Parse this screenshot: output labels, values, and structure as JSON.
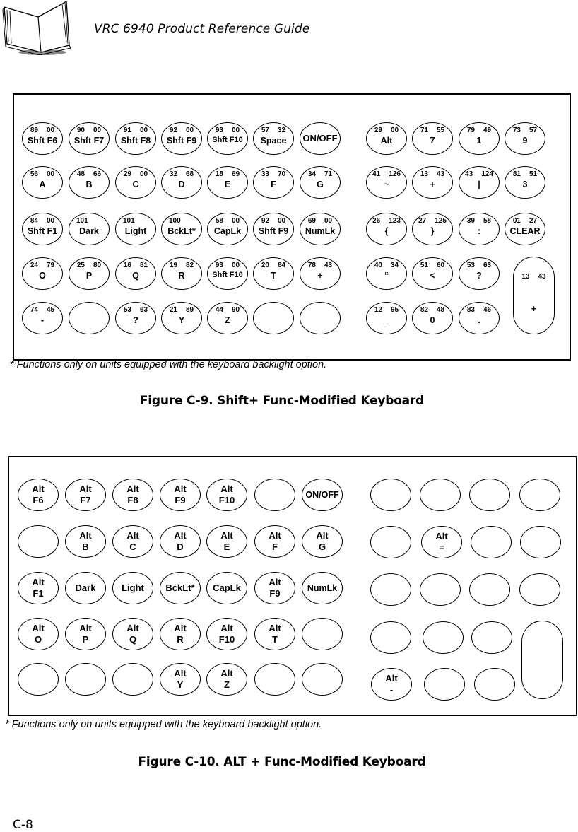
{
  "header": {
    "title": "VRC 6940 Product Reference Guide",
    "icon": "open-book-icon"
  },
  "figure_c9": {
    "caption": "Figure C-9.  Shift+ Func-Modified Keyboard",
    "note": "* Functions only on units equipped with the keyboard backlight option.",
    "main_rows": [
      [
        {
          "codes": [
            "89",
            "00"
          ],
          "label": "Shft F6"
        },
        {
          "codes": [
            "90",
            "00"
          ],
          "label": "Shft F7"
        },
        {
          "codes": [
            "91",
            "00"
          ],
          "label": "Shft F8"
        },
        {
          "codes": [
            "92",
            "00"
          ],
          "label": "Shft F9"
        },
        {
          "codes": [
            "93",
            "00"
          ],
          "label": "Shft F10"
        },
        {
          "codes": [
            "57",
            "32"
          ],
          "label": "Space"
        },
        {
          "codes": [],
          "label": "ON/OFF"
        }
      ],
      [
        {
          "codes": [
            "56",
            "00"
          ],
          "label": "A"
        },
        {
          "codes": [
            "48",
            "66"
          ],
          "label": "B"
        },
        {
          "codes": [
            "29",
            "00"
          ],
          "label": "C"
        },
        {
          "codes": [
            "32",
            "68"
          ],
          "label": "D"
        },
        {
          "codes": [
            "18",
            "69"
          ],
          "label": "E"
        },
        {
          "codes": [
            "33",
            "70"
          ],
          "label": "F"
        },
        {
          "codes": [
            "34",
            "71"
          ],
          "label": "G"
        }
      ],
      [
        {
          "codes": [
            "84",
            "00"
          ],
          "label": "Shft F1"
        },
        {
          "codes": [
            "101"
          ],
          "label": "Dark"
        },
        {
          "codes": [
            "101"
          ],
          "label": "Light"
        },
        {
          "codes": [
            "100"
          ],
          "label": "BckLt*"
        },
        {
          "codes": [
            "58",
            "00"
          ],
          "label": "CapLk"
        },
        {
          "codes": [
            "92",
            "00"
          ],
          "label": "Shft F9"
        },
        {
          "codes": [
            "69",
            "00"
          ],
          "label": "NumLk"
        }
      ],
      [
        {
          "codes": [
            "24",
            "79"
          ],
          "label": "O"
        },
        {
          "codes": [
            "25",
            "80"
          ],
          "label": "P"
        },
        {
          "codes": [
            "16",
            "81"
          ],
          "label": "Q"
        },
        {
          "codes": [
            "19",
            "82"
          ],
          "label": "R"
        },
        {
          "codes": [
            "93",
            "00"
          ],
          "label": "Shft F10"
        },
        {
          "codes": [
            "20",
            "84"
          ],
          "label": "T"
        },
        {
          "codes": [
            "78",
            "43"
          ],
          "label": "+"
        }
      ],
      [
        {
          "codes": [
            "74",
            "45"
          ],
          "label": "-"
        },
        {
          "codes": [],
          "label": ""
        },
        {
          "codes": [
            "53",
            "63"
          ],
          "label": "?"
        },
        {
          "codes": [
            "21",
            "89"
          ],
          "label": "Y"
        },
        {
          "codes": [
            "44",
            "90"
          ],
          "label": "Z"
        },
        {
          "codes": [],
          "label": ""
        },
        {
          "codes": [],
          "label": ""
        }
      ]
    ],
    "keypad_rows": [
      [
        {
          "codes": [
            "29",
            "00"
          ],
          "label": "Alt"
        },
        {
          "codes": [
            "71",
            "55"
          ],
          "label": "7"
        },
        {
          "codes": [
            "79",
            "49"
          ],
          "label": "1"
        },
        {
          "codes": [
            "73",
            "57"
          ],
          "label": "9"
        }
      ],
      [
        {
          "codes": [
            "41",
            "126"
          ],
          "label": "~"
        },
        {
          "codes": [
            "13",
            "43"
          ],
          "label": "+"
        },
        {
          "codes": [
            "43",
            "124"
          ],
          "label": "|"
        },
        {
          "codes": [
            "81",
            "51"
          ],
          "label": "3"
        }
      ],
      [
        {
          "codes": [
            "26",
            "123"
          ],
          "label": "{"
        },
        {
          "codes": [
            "27",
            "125"
          ],
          "label": "}"
        },
        {
          "codes": [
            "39",
            "58"
          ],
          "label": ":"
        },
        {
          "codes": [
            "01",
            "27"
          ],
          "label": "CLEAR"
        }
      ],
      [
        {
          "codes": [
            "40",
            "34"
          ],
          "label": "“"
        },
        {
          "codes": [
            "51",
            "60"
          ],
          "label": "<"
        },
        {
          "codes": [
            "53",
            "63"
          ],
          "label": "?"
        }
      ],
      [
        {
          "codes": [
            "12",
            "95"
          ],
          "label": "_"
        },
        {
          "codes": [
            "82",
            "48"
          ],
          "label": "0"
        },
        {
          "codes": [
            "83",
            "46"
          ],
          "label": "."
        }
      ]
    ],
    "tall_key": {
      "codes": [
        "13",
        "43"
      ],
      "label": "+"
    }
  },
  "figure_c10": {
    "caption": "Figure C-10.  ALT + Func-Modified Keyboard",
    "note": "* Functions only on units equipped with the keyboard backlight option.",
    "main_rows": [
      [
        "Alt\nF6",
        "Alt\nF7",
        "Alt\nF8",
        "Alt\nF9",
        "Alt\nF10",
        "",
        "ON/OFF"
      ],
      [
        "",
        "Alt\nB",
        "Alt\nC",
        "Alt\nD",
        "Alt\nE",
        "Alt\nF",
        "Alt\nG"
      ],
      [
        "Alt\nF1",
        "Dark",
        "Light",
        "BckLt*",
        "CapLk",
        "Alt\nF9",
        "NumLk"
      ],
      [
        "Alt\nO",
        "Alt\nP",
        "Alt\nQ",
        "Alt\nR",
        "Alt\nF10",
        "Alt\nT",
        ""
      ],
      [
        "",
        "",
        "",
        "Alt\nY",
        "Alt\nZ",
        "",
        ""
      ]
    ],
    "keypad_rows": [
      [
        "",
        "",
        "",
        ""
      ],
      [
        "",
        "Alt\n=",
        "",
        ""
      ],
      [
        "",
        "",
        "",
        ""
      ],
      [
        "",
        "",
        ""
      ],
      [
        "Alt\n-",
        "",
        ""
      ]
    ],
    "tall_key": {
      "label": ""
    }
  },
  "footer": {
    "page_number": "C-8"
  }
}
